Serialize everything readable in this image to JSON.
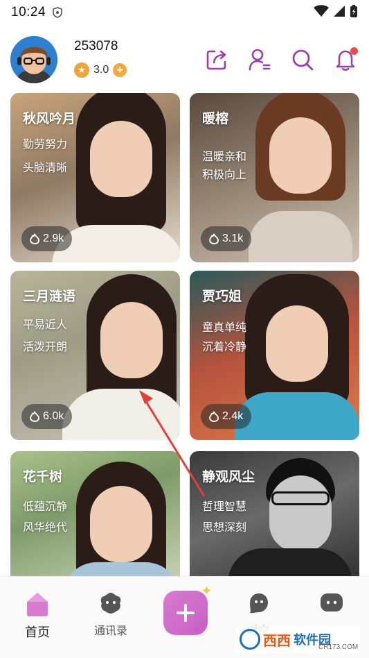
{
  "status_bar": {
    "time": "10:24"
  },
  "header": {
    "user_id": "253078",
    "coin_value": "3.0",
    "plus": "+"
  },
  "cards": [
    {
      "name": "秋风吟月",
      "tags": [
        "勤劳努力",
        "头脑清晰"
      ],
      "heat": "2.9k"
    },
    {
      "name": "暖榕",
      "tags": [
        "温暖亲和",
        "积极向上"
      ],
      "heat": "3.1k"
    },
    {
      "name": "三月涟语",
      "tags": [
        "平易近人",
        "活泼开朗"
      ],
      "heat": "6.0k"
    },
    {
      "name": "贾巧姐",
      "tags": [
        "童真单纯",
        "沉着冷静"
      ],
      "heat": "2.4k"
    },
    {
      "name": "花千树",
      "tags": [
        "低蕴沉静",
        "风华绝代"
      ],
      "heat": ""
    },
    {
      "name": "静观风尘",
      "tags": [
        "哲理智慧",
        "思想深刻"
      ],
      "heat": ""
    }
  ],
  "tabs": [
    {
      "label": "首页"
    },
    {
      "label": "通讯录"
    },
    {
      "label": "时空"
    },
    {
      "label": ""
    }
  ],
  "watermark": {
    "brand_a": "西西",
    "brand_b": "软件园",
    "domain": "CR173.COM"
  },
  "colors": {
    "accent": "#9b3fb0",
    "active_tab": "#d77bd1",
    "notif": "#f04848",
    "coin": "#f2a23a"
  }
}
